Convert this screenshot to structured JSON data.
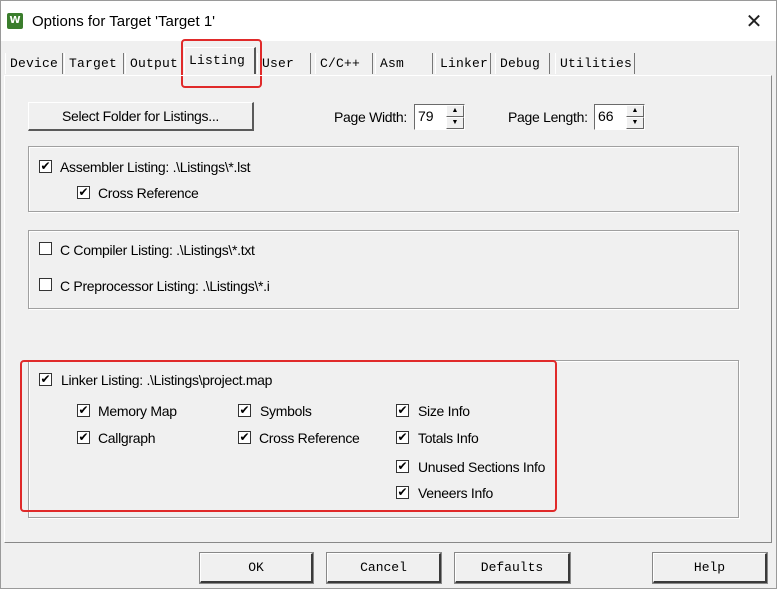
{
  "window": {
    "title": "Options for Target 'Target 1'",
    "close_glyph": "✕",
    "app_icon_glyph": "W"
  },
  "tabs": [
    {
      "label": "Device"
    },
    {
      "label": "Target"
    },
    {
      "label": "Output"
    },
    {
      "label": "Listing"
    },
    {
      "label": "User"
    },
    {
      "label": "C/C++"
    },
    {
      "label": "Asm"
    },
    {
      "label": "Linker"
    },
    {
      "label": "Debug"
    },
    {
      "label": "Utilities"
    }
  ],
  "active_tab": "Listing",
  "listing": {
    "select_folder_label": "Select Folder for Listings...",
    "page_width_label": "Page Width:",
    "page_width_value": "79",
    "page_length_label": "Page Length:",
    "page_length_value": "66",
    "assembler": {
      "label": "Assembler Listing:  .\\Listings\\*.lst",
      "checked": true,
      "cross_reference": {
        "label": "Cross Reference",
        "checked": true
      }
    },
    "c_compiler": {
      "label": "C Compiler Listing:  .\\Listings\\*.txt",
      "checked": false
    },
    "c_preprocessor": {
      "label": "C Preprocessor Listing:  .\\Listings\\*.i",
      "checked": false
    },
    "linker": {
      "label": "Linker Listing:  .\\Listings\\project.map",
      "checked": true,
      "options": [
        {
          "label": "Memory Map",
          "checked": true
        },
        {
          "label": "Symbols",
          "checked": true
        },
        {
          "label": "Size Info",
          "checked": true
        },
        {
          "label": "Callgraph",
          "checked": true
        },
        {
          "label": "Cross Reference",
          "checked": true
        },
        {
          "label": "Totals Info",
          "checked": true
        },
        {
          "label": "Unused Sections Info",
          "checked": true
        },
        {
          "label": "Veneers Info",
          "checked": true
        }
      ]
    }
  },
  "buttons": {
    "ok": "OK",
    "cancel": "Cancel",
    "defaults": "Defaults",
    "help": "Help"
  },
  "check_glyph": "✔",
  "colors": {
    "highlight": "#e02a2a",
    "dialog_bg": "#f0f0f0"
  }
}
